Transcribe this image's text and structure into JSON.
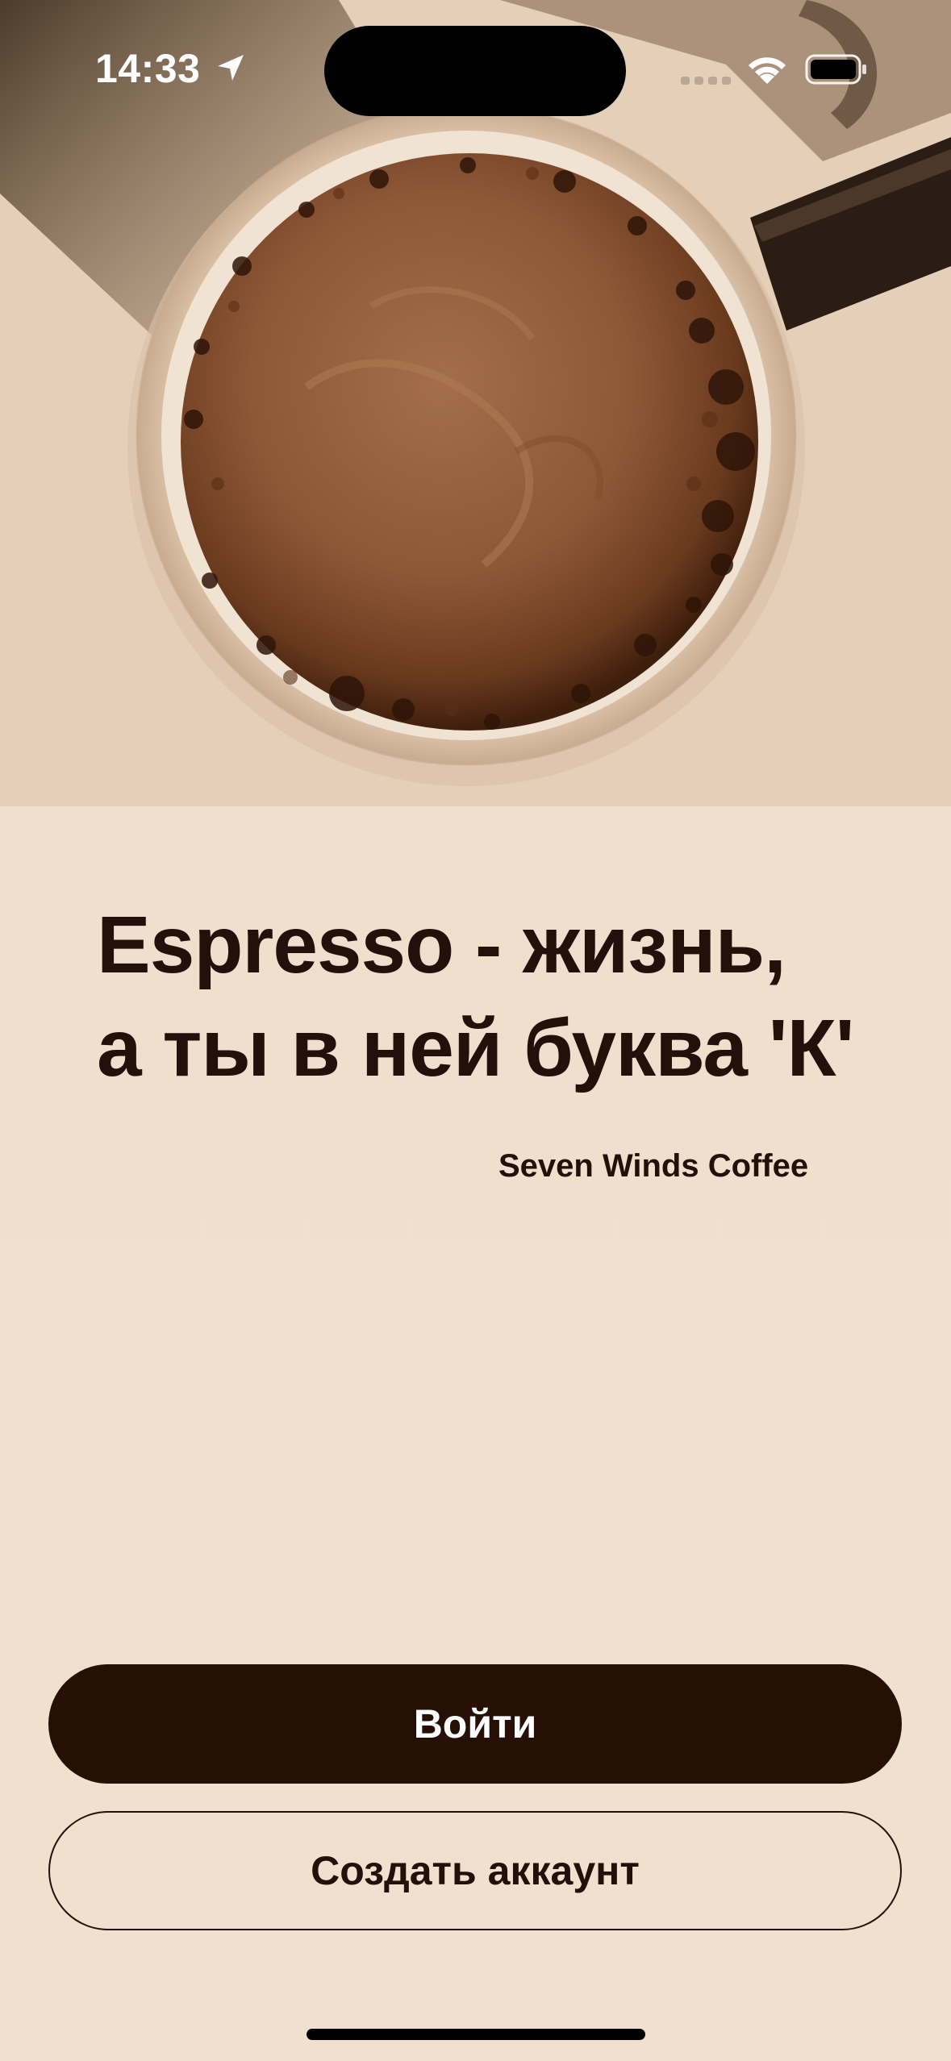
{
  "status_bar": {
    "time": "14:33",
    "icons": [
      "location-arrow-icon",
      "cellular-signal-icon",
      "wifi-icon",
      "battery-icon"
    ]
  },
  "hero": {
    "image": "coffee-cup-top-view"
  },
  "headline": {
    "line1": "Espresso - жизнь,",
    "line2": "а ты в ней буква 'К'"
  },
  "brand": "Seven Winds Coffee",
  "buttons": {
    "login": "Войти",
    "register": "Создать аккаунт"
  },
  "colors": {
    "background": "#efdecb",
    "primary": "#261006",
    "text": "#22100a"
  }
}
